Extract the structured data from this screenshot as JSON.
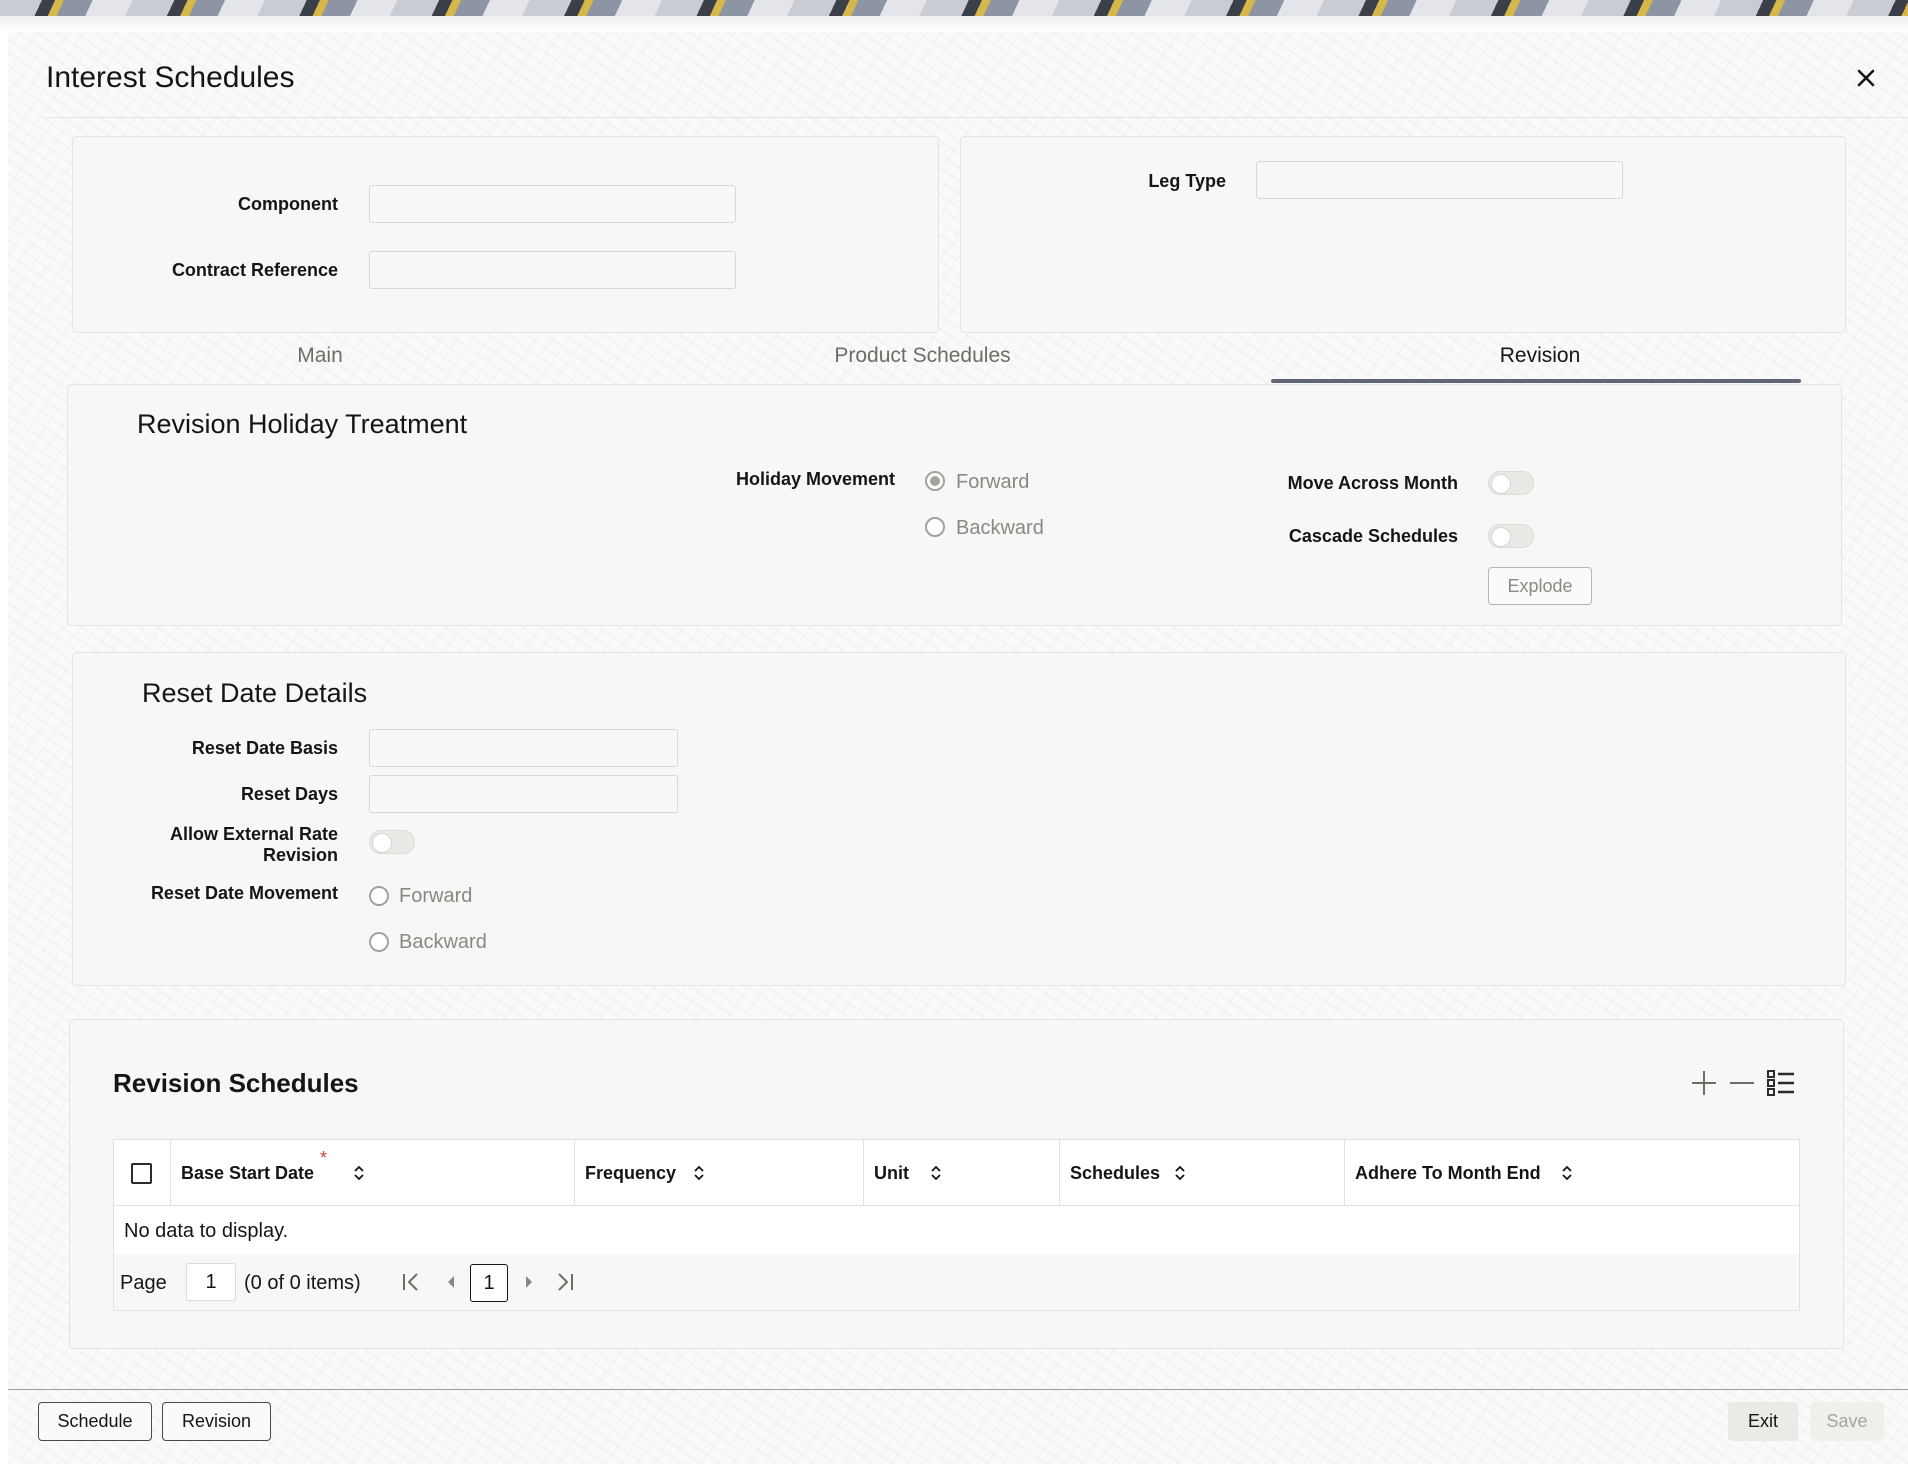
{
  "window": {
    "title": "Interest Schedules",
    "close_icon": "close-icon"
  },
  "header_panel": {
    "component_label": "Component",
    "component_value": "",
    "contract_reference_label": "Contract Reference",
    "contract_reference_value": "",
    "leg_type_label": "Leg Type",
    "leg_type_value": ""
  },
  "tabs": [
    {
      "label": "Main",
      "active": false
    },
    {
      "label": "Product Schedules",
      "active": false
    },
    {
      "label": "Revision",
      "active": true
    }
  ],
  "revision_holiday": {
    "title": "Revision Holiday Treatment",
    "holiday_movement_label": "Holiday Movement",
    "forward_label": "Forward",
    "backward_label": "Backward",
    "selected": "Forward",
    "move_across_month_label": "Move Across Month",
    "move_across_month": false,
    "cascade_schedules_label": "Cascade Schedules",
    "cascade_schedules": false,
    "explode_label": "Explode"
  },
  "reset_date": {
    "title": "Reset Date Details",
    "reset_date_basis_label": "Reset Date Basis",
    "reset_date_basis_value": "",
    "reset_days_label": "Reset Days",
    "reset_days_value": "",
    "allow_external_line1": "Allow External Rate",
    "allow_external_line2": "Revision",
    "allow_external": false,
    "reset_date_movement_label": "Reset Date Movement",
    "forward_label": "Forward",
    "backward_label": "Backward"
  },
  "revision_schedules": {
    "title": "Revision Schedules",
    "icons": [
      "add-icon",
      "remove-icon",
      "single-record-view-icon"
    ],
    "columns": [
      {
        "label": "Base Start Date",
        "required": true
      },
      {
        "label": "Frequency",
        "required": false
      },
      {
        "label": "Unit",
        "required": false
      },
      {
        "label": "Schedules",
        "required": false
      },
      {
        "label": "Adhere To Month End",
        "required": false
      }
    ],
    "required_mark": "*",
    "empty_text": "No data to display.",
    "pager": {
      "page_label": "Page",
      "page_value": "1",
      "items_text": "(0 of 0 items)",
      "current_page": "1"
    }
  },
  "footer": {
    "schedule_label": "Schedule",
    "revision_label": "Revision",
    "exit_label": "Exit",
    "save_label": "Save"
  },
  "colors": {
    "tab_underline": "#5f6678",
    "required": "#c74634"
  }
}
